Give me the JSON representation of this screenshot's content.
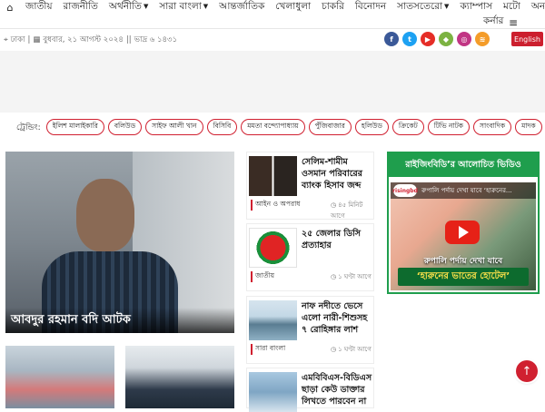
{
  "nav": {
    "items": [
      {
        "label": "জাতীয়",
        "has_caret": false
      },
      {
        "label": "রাজনীতি",
        "has_caret": false
      },
      {
        "label": "অর্থনীতি",
        "has_caret": true
      },
      {
        "label": "সারা বাংলা",
        "has_caret": true
      },
      {
        "label": "আন্তর্জাতিক",
        "has_caret": false
      },
      {
        "label": "খেলাধুলা",
        "has_caret": false
      },
      {
        "label": "চাকরি",
        "has_caret": false
      },
      {
        "label": "বিনোদন",
        "has_caret": false
      },
      {
        "label": "সাতসতেরো",
        "has_caret": true
      },
      {
        "label": "ক্যাম্পাস",
        "has_caret": false
      },
      {
        "label": "মটো",
        "has_caret": false
      },
      {
        "label": "অন্যান্য",
        "has_caret": false
      }
    ],
    "second_row_item": "কর্নার"
  },
  "dateline": {
    "location": "ঢাকা",
    "day_date": "বুধবার, ২১ আগস্ট ২০২৪",
    "bangla_date": "ভাদ্র ৬ ১৪৩১"
  },
  "social": [
    {
      "name": "facebook-icon",
      "glyph": "f",
      "color": "#3b5998"
    },
    {
      "name": "twitter-icon",
      "glyph": "t",
      "color": "#1da1f2"
    },
    {
      "name": "youtube-icon",
      "glyph": "▶",
      "color": "#e52d27"
    },
    {
      "name": "android-icon",
      "glyph": "◆",
      "color": "#7cb342"
    },
    {
      "name": "instagram-icon",
      "glyph": "◎",
      "color": "#c13584"
    },
    {
      "name": "rss-icon",
      "glyph": "≋",
      "color": "#f49c29"
    }
  ],
  "english_button": "English",
  "trending": {
    "label": "ট্রেন্ডিং:",
    "tags": [
      "ইলিশ মালাইকারি",
      "বলিউড",
      "সাইফ আলী খান",
      "বিসিবি",
      "মমতা বন্দ্যোপাধ্যায়",
      "পুঁজিবাজার",
      "হলিউড",
      "ক্রিকেট",
      "টিভি নাটক",
      "সাংবাদিক",
      "মাদক"
    ]
  },
  "lead": {
    "caption": "আবদুর রহমান বদি আটক"
  },
  "news": [
    {
      "title": "সেলিম-শামীম ওসমান পরিবারের ব্যাংক হিসাব জব্দ",
      "category": "আইন ও অপরাধ",
      "time": "৪৫ মিনিট আগে"
    },
    {
      "title": "২৫ জেলার ডিসি প্রত্যাহার",
      "category": "জাতীয়",
      "time": "১ ঘণ্টা আগে"
    },
    {
      "title": "নাফ নদীতে ভেসে এলো নারী-শিশুসহ ৭ রোহিঙ্গার লাশ",
      "category": "সারা বাংলা",
      "time": "১ ঘণ্টা আগে"
    },
    {
      "title": "এমবিবিএস-বিডিএস ছাড়া কেউ ডাক্তার লিখতে পারবেন না",
      "category": "",
      "time": ""
    }
  ],
  "video": {
    "heading": "রাইজিংবিডি’র আলোচিত ভিডিও",
    "top_text": "রুপালি পর্দায় দেখা যাবে ‘হারুনের...",
    "channel_logo": "risingbd",
    "line1": "রুপালি পর্দায় দেখা যাবে",
    "line2": "‘হারুনের ভাতের হোটেল’"
  },
  "colors": {
    "accent": "#d02030",
    "video_green": "#1f9e4d"
  }
}
